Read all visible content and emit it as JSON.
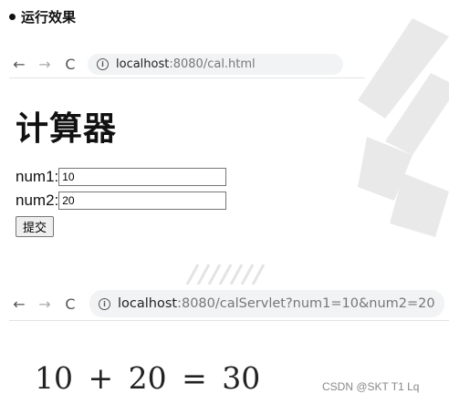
{
  "section_title": "运行效果",
  "browser1": {
    "back": "←",
    "forward": "→",
    "reload": "C",
    "info": "i",
    "url_host": "localhost",
    "url_rest": ":8080/cal.html"
  },
  "page1": {
    "heading": "计算器",
    "num1_label": "num1:",
    "num1_value": "10",
    "num2_label": "num2:",
    "num2_value": "20",
    "submit_label": "提交"
  },
  "browser2": {
    "back": "←",
    "forward": "→",
    "reload": "C",
    "info": "i",
    "url_host": "localhost",
    "url_rest": ":8080/calServlet?num1=10&num2=20"
  },
  "result": "10 + 20 = 30",
  "credit": "CSDN @SKT T1 Lq"
}
